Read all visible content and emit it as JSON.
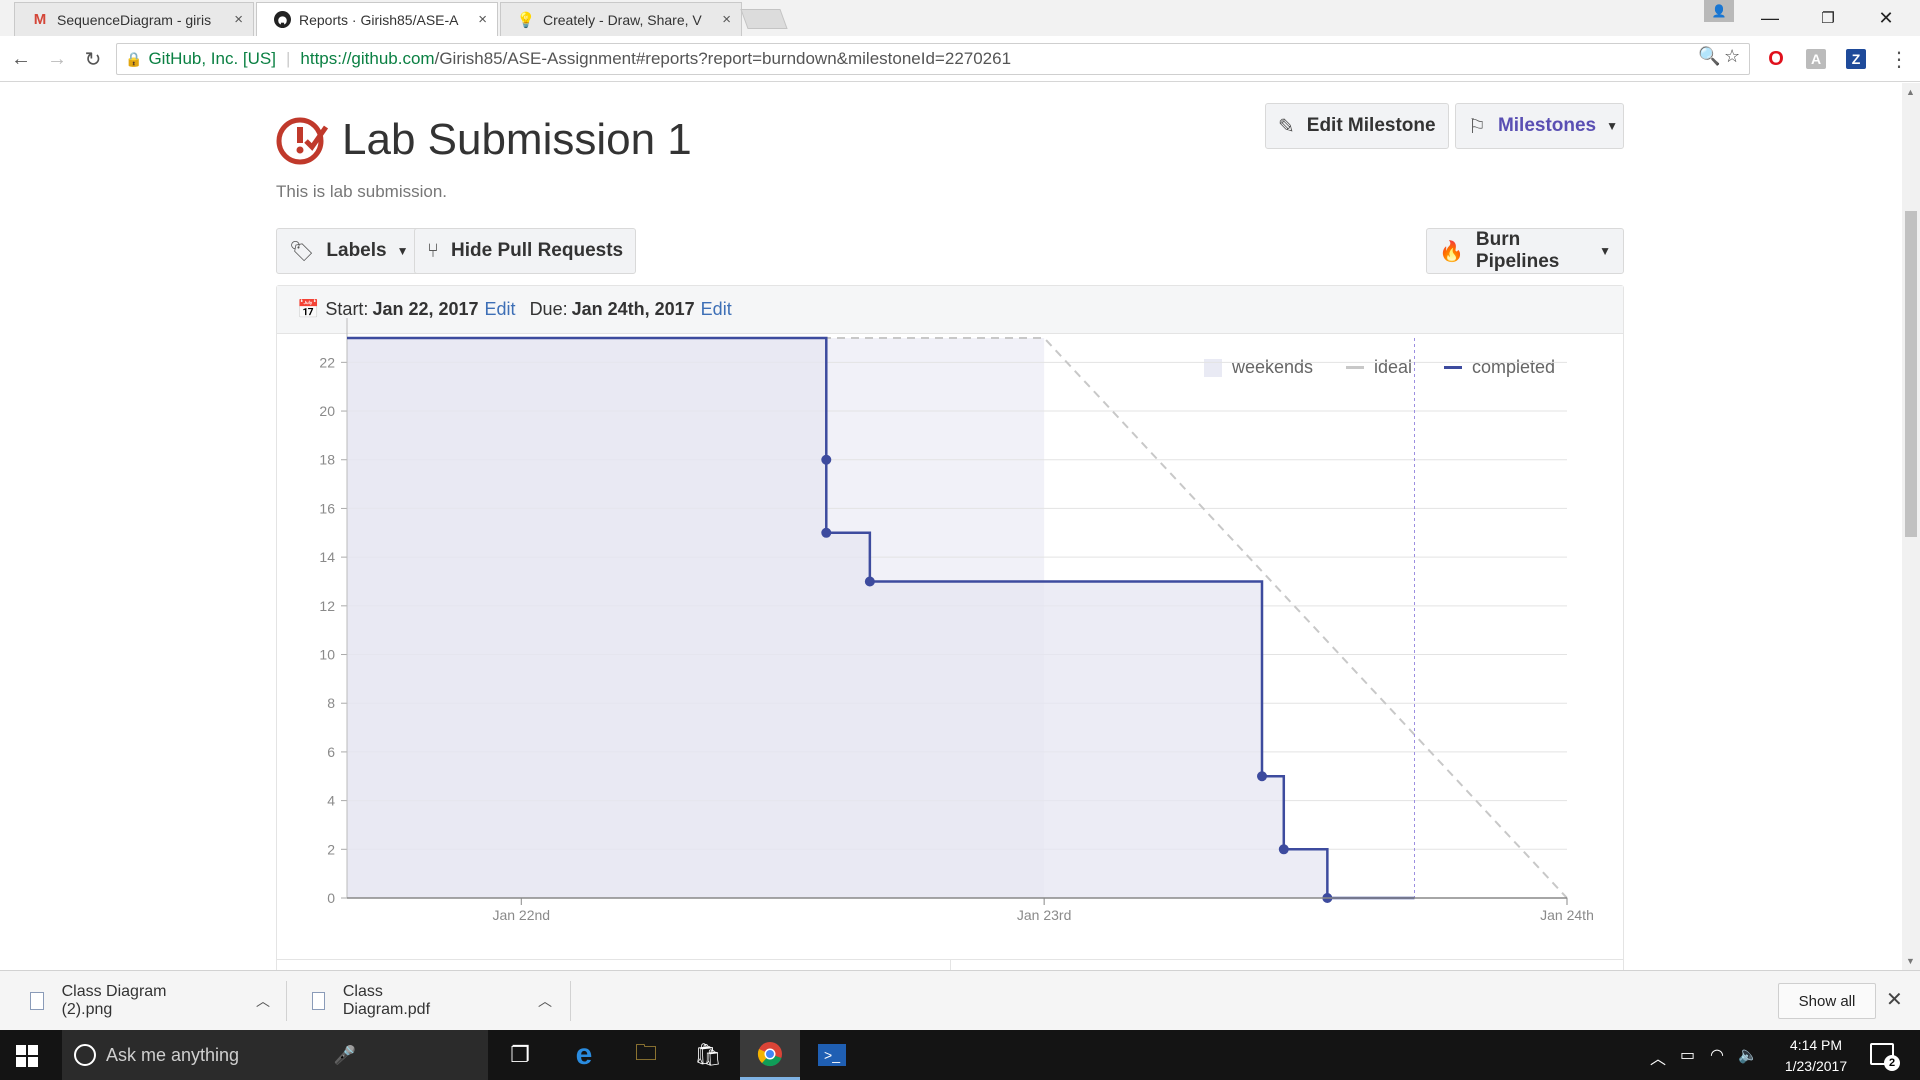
{
  "browser": {
    "tabs": [
      {
        "title": "SequenceDiagram - giris",
        "favicon": "gmail-icon",
        "active": false
      },
      {
        "title": "Reports · Girish85/ASE-A",
        "favicon": "github-icon",
        "active": true
      },
      {
        "title": "Creately - Draw, Share, V",
        "favicon": "creately-icon",
        "active": false
      }
    ],
    "window_controls": {
      "minimize": "—",
      "restore": "❐",
      "close": "✕"
    },
    "address": {
      "org_label": "GitHub, Inc. [US]",
      "url_host": "https://github.com",
      "url_path": "/Girish85/ASE-Assignment#reports?report=burndown&milestoneId=2270261"
    },
    "extensions": [
      "opera-icon",
      "acrobat-icon",
      "zotero-icon"
    ]
  },
  "milestone": {
    "title": "Lab Submission 1",
    "description": "This is lab submission.",
    "edit_button": "Edit Milestone",
    "milestones_button": "Milestones"
  },
  "filters": {
    "labels_button": "Labels",
    "hide_prs_button": "Hide Pull Requests",
    "burn_pipelines_button": "Burn Pipelines"
  },
  "dates": {
    "start_label": "Start:",
    "start_value": "Jan 22, 2017",
    "start_edit": "Edit",
    "due_label": "Due:",
    "due_value": "Jan 24th, 2017",
    "due_edit": "Edit"
  },
  "chart_data": {
    "type": "line",
    "title": "",
    "xlabel": "",
    "ylabel": "",
    "x_ticks": [
      "Jan 22nd",
      "Jan 23rd",
      "Jan 24th"
    ],
    "y_ticks": [
      0,
      2,
      4,
      6,
      8,
      10,
      12,
      14,
      16,
      18,
      20,
      22
    ],
    "xlim": [
      "Jan 21 16:00",
      "Jan 24 00:00"
    ],
    "ylim": [
      0,
      23
    ],
    "grid": true,
    "legend": [
      "weekends",
      "ideal",
      "completed"
    ],
    "legend_position": "top-right",
    "colors": {
      "completed": "#3d4b9e",
      "ideal": "#c8c8c8",
      "weekends": "#f1f1f8",
      "area": "#e5e6f2",
      "due_line": "#9b8ee0"
    },
    "weekend_span": [
      "Jan 21 16:00",
      "Jan 23 00:00"
    ],
    "ideal": [
      {
        "x": "Jan 21 16:00",
        "y": 23
      },
      {
        "x": "Jan 23 00:00",
        "y": 23
      },
      {
        "x": "Jan 24 00:00",
        "y": 0
      }
    ],
    "completed_steps": [
      {
        "x": "Jan 21 16:00",
        "y": 23,
        "marker": false
      },
      {
        "x": "Jan 22 14:00",
        "y": 18,
        "marker": true
      },
      {
        "x": "Jan 22 14:00",
        "y": 15,
        "marker": true
      },
      {
        "x": "Jan 22 16:00",
        "y": 13,
        "marker": true
      },
      {
        "x": "Jan 23 10:00",
        "y": 5,
        "marker": true
      },
      {
        "x": "Jan 23 11:00",
        "y": 2,
        "marker": true
      },
      {
        "x": "Jan 23 13:00",
        "y": 0,
        "marker": true
      },
      {
        "x": "Jan 23 17:00",
        "y": 0,
        "marker": false
      }
    ],
    "due_marker": "Jan 23 17:00"
  },
  "downloads": {
    "items": [
      {
        "name": "Class Diagram (2).png"
      },
      {
        "name": "Class Diagram.pdf"
      }
    ],
    "show_all": "Show all"
  },
  "taskbar": {
    "search_placeholder": "Ask me anything",
    "time": "4:14 PM",
    "date": "1/23/2017",
    "notifications": "2"
  }
}
